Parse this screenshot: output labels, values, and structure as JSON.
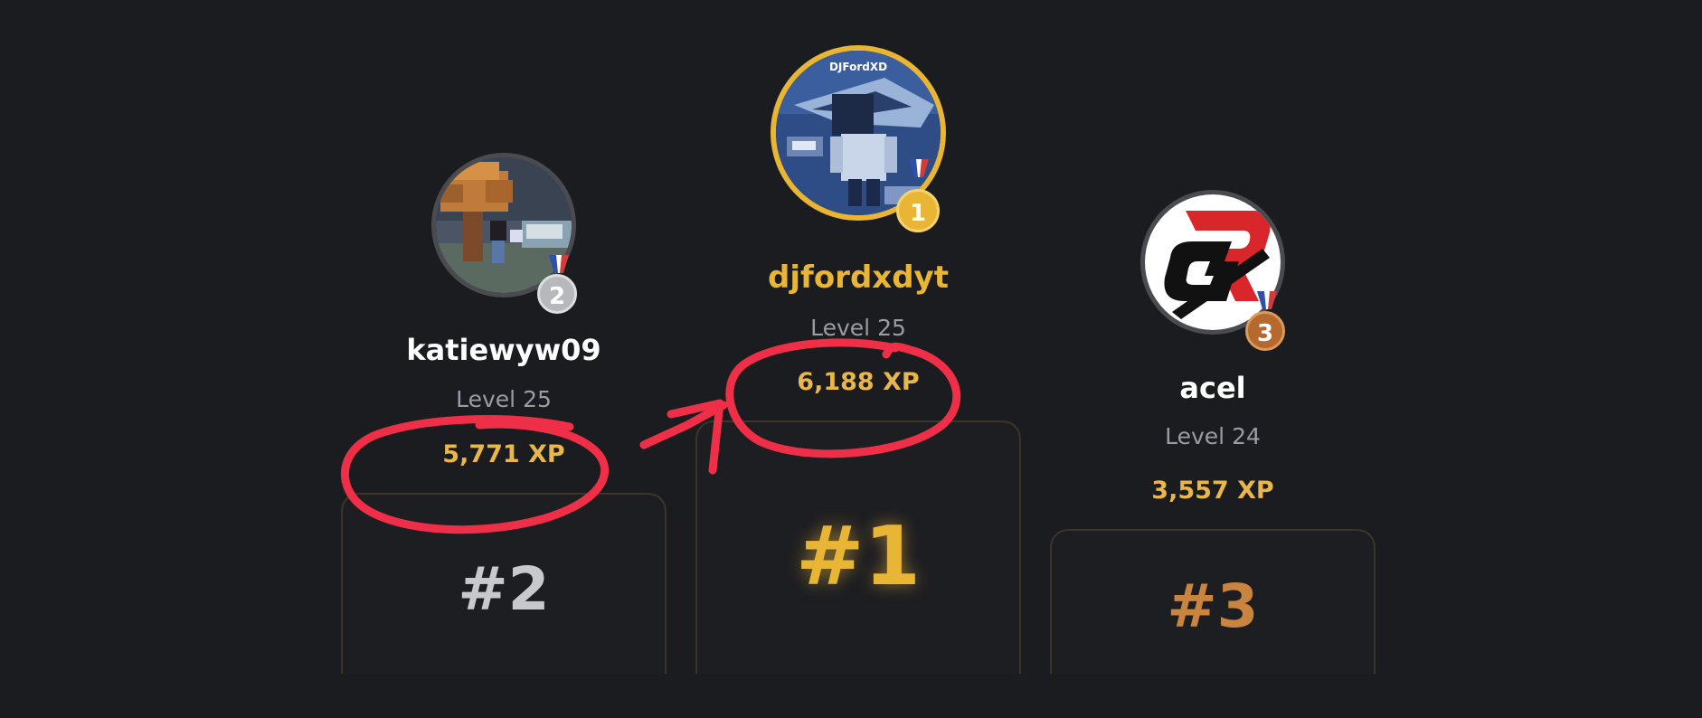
{
  "leaderboard": {
    "podium": [
      {
        "position": "second",
        "username": "katiewyw09",
        "level": "Level 25",
        "xp": "5,771 XP",
        "rank_label": "#2",
        "medal_number": "2",
        "medal_color": "#b7b8bc",
        "avatar_icon": "minecraft-tree-scene"
      },
      {
        "position": "first",
        "username": "djfordxdyt",
        "level": "Level 25",
        "xp": "6,188 XP",
        "rank_label": "#1",
        "medal_number": "1",
        "medal_color": "#e9b535",
        "avatar_caption": "DJFordXD",
        "avatar_icon": "minecraft-skin-blue"
      },
      {
        "position": "third",
        "username": "acel",
        "level": "Level 24",
        "xp": "3,557 XP",
        "rank_label": "#3",
        "medal_number": "3",
        "medal_color": "#c27a3c",
        "avatar_icon": "red-black-r-logo"
      }
    ]
  },
  "colors": {
    "background": "#1b1c20",
    "gold": "#e9b535",
    "silver": "#c8c9cc",
    "bronze": "#c9843f",
    "xp": "#e8b64a",
    "annotation_red": "#ef2f47"
  }
}
